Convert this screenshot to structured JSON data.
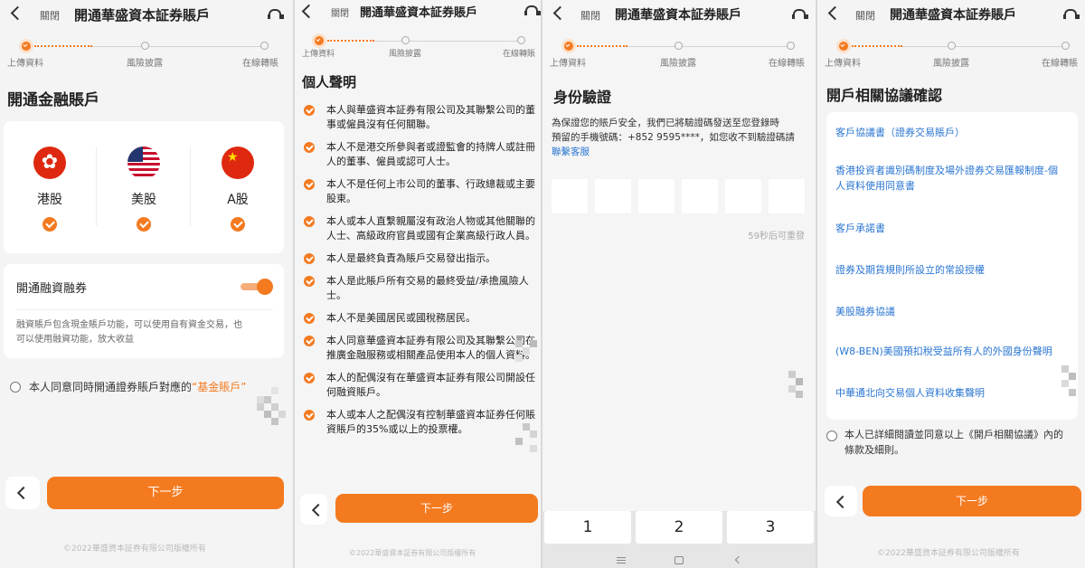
{
  "header": {
    "close": "關閉",
    "title": "開通華盛資本証券賬戶"
  },
  "steps": [
    "上傳資料",
    "風險披露",
    "在線轉賬"
  ],
  "screen1": {
    "title": "開通金融賬戶",
    "markets": [
      {
        "label": "港股",
        "flag": "hong-kong-flag-icon"
      },
      {
        "label": "美股",
        "flag": "us-flag-icon"
      },
      {
        "label": "A股",
        "flag": "china-flag-icon"
      }
    ],
    "margin_title": "開通融資融券",
    "margin_desc_1": "融資賬戶包含現金賬戶功能，可以使用自有資金交易，也",
    "margin_desc_2": "可以使用融資功能，放大收益",
    "agree_text": "本人同意同時開通證券賬戶對應的",
    "agree_link": "“基金賬戶”"
  },
  "screen2": {
    "title": "個人聲明",
    "items": [
      [
        "本人與華盛資本証券有限公司及其聯繫公司的董",
        "事或僱員沒有任何關聯。"
      ],
      [
        "本人不是港交所參與者或證監會的持牌人或註冊",
        "人的董事、僱員或認可人士。"
      ],
      [
        "本人不是任何上市公司的董事、行政總裁或主要",
        "股東。"
      ],
      [
        "本人或本人直繫親屬沒有政治人物或其他關聯的",
        "人士、高級政府官員或國有企業高級行政人員。"
      ],
      [
        "本人是最終負責為賬戶交易發出指示。"
      ],
      [
        "本人是此賬戶所有交易的最終受益/承擔風險人",
        "士。"
      ],
      [
        "本人不是美國居民或國稅務居民。"
      ],
      [
        "本人同意華盛資本証券有限公司及其聯繫公司在",
        "推廣金融服務或相關產品使用本人的個人資料。"
      ],
      [
        "本人的配偶沒有在華盛資本証券有限公司開設任",
        "何融資賬戶。"
      ],
      [
        "本人或本人之配偶沒有控制華盛資本証券任何賬",
        "資賬戶的35%或以上的投票權。"
      ]
    ]
  },
  "screen3": {
    "title": "身份驗證",
    "desc_1": "為保證您的賬戶安全，我們已將驗證碼發送至您登錄時",
    "desc_2": "預留的手機號碼：+852 9595****，如您收不到驗證碼請",
    "contact": "聯繫客服",
    "resend": "59秒后可重發",
    "keys": [
      "1",
      "2",
      "3"
    ]
  },
  "screen4": {
    "title": "開戶相關協議確認",
    "links": [
      [
        "客戶協議書（證券交易賬戶）"
      ],
      [
        "香港投資者識別碼制度及場外證券交易匯報制度-個",
        "人資料使用同意書"
      ],
      [
        "客戶承諾書"
      ],
      [
        "證券及期貨規則所設立的常設授權"
      ],
      [
        "美股融券協議"
      ],
      [
        "(W8-BEN)美國預扣稅受益所有人的外國身份聲明"
      ],
      [
        "中華通北向交易個人資料收集聲明"
      ]
    ],
    "agree_1": "本人已詳細閱讀並同意以上《開戶相關協議》內的",
    "agree_2": "條款及細則。"
  },
  "buttons": {
    "next": "下一步"
  },
  "footer": "©2022華盛資本証券有限公司版權所有",
  "colors": {
    "accent": "#f47a20",
    "link": "#2a76d2"
  }
}
